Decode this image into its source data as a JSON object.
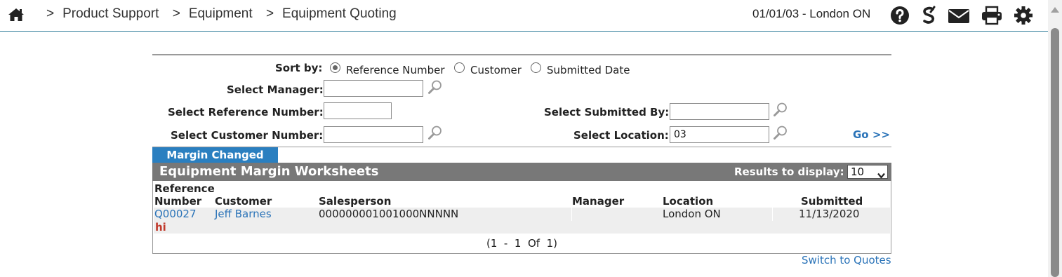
{
  "breadcrumb": {
    "separator": ">",
    "items": [
      "Product Support",
      "Equipment",
      "Equipment Quoting"
    ]
  },
  "header": {
    "date_location": "01/01/03 - London ON",
    "icons": [
      "help-icon",
      "s-logo-icon",
      "mail-icon",
      "print-icon",
      "gear-icon"
    ]
  },
  "filters": {
    "sort_label": "Sort by:",
    "sort_options": [
      "Reference Number",
      "Customer",
      "Submitted Date"
    ],
    "sort_selected": "Reference Number",
    "manager_label": "Select Manager:",
    "manager_value": "",
    "reference_label": "Select Reference Number:",
    "reference_value": "",
    "customer_label": "Select Customer Number:",
    "customer_value": "",
    "submitted_by_label": "Select Submitted By:",
    "submitted_by_value": "",
    "location_label": "Select Location:",
    "location_value": "03",
    "go_label": "Go >>"
  },
  "tab": {
    "label": "Margin Changed"
  },
  "grid": {
    "title": "Equipment Margin Worksheets",
    "results_label": "Results to display:",
    "results_value": "10",
    "columns": {
      "reference_line1": "Reference",
      "reference_line2": "Number",
      "customer": "Customer",
      "salesperson": "Salesperson",
      "manager": "Manager",
      "location": "Location",
      "submitted": "Submitted"
    },
    "rows": [
      {
        "reference": "Q00027",
        "customer": "Jeff Barnes",
        "salesperson": "000000001001000NNNNN",
        "manager": "",
        "location": "London ON",
        "submitted": "11/13/2020",
        "note": "hi"
      }
    ],
    "pager": "(1  -  1  Of  1)"
  },
  "footer": {
    "switch_link": "Switch to Quotes"
  },
  "colors": {
    "accent": "#2a7fc0",
    "link": "#2a73b8",
    "header_bg": "#787878",
    "note": "#c0392b"
  }
}
